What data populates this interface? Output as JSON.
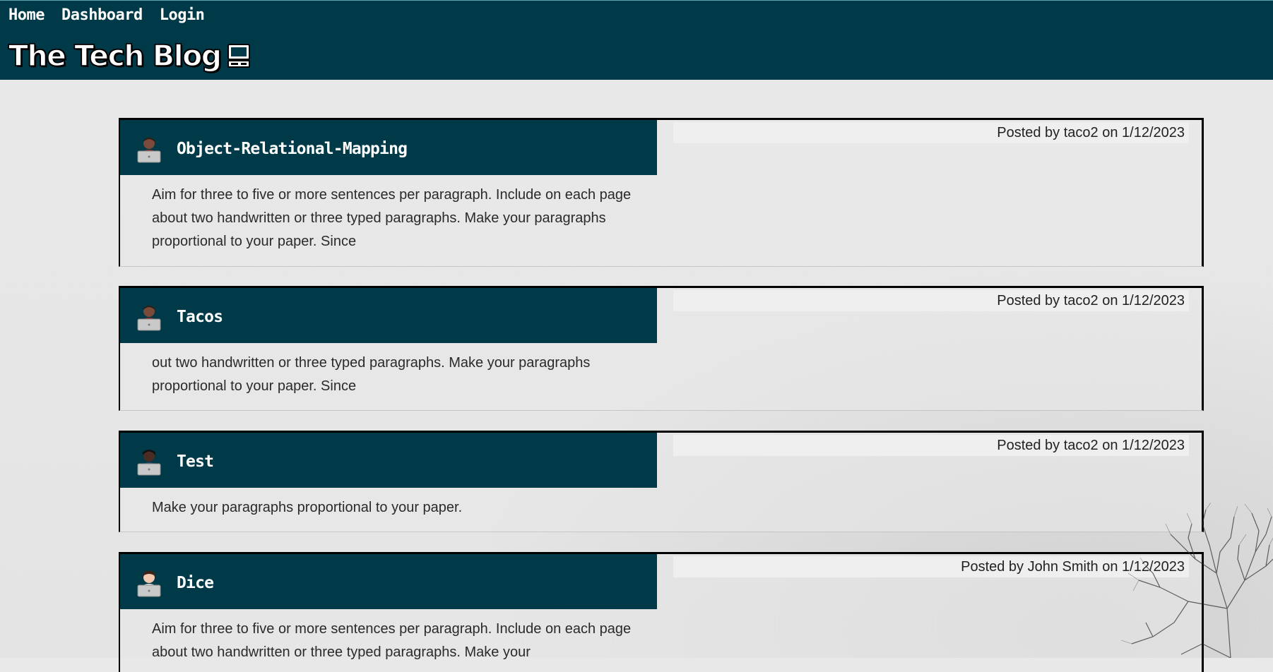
{
  "nav": {
    "home": "Home",
    "dashboard": "Dashboard",
    "login": "Login"
  },
  "site": {
    "title": "The Tech Blog",
    "icon": "computer-icon"
  },
  "posts": [
    {
      "title": "Object-Relational-Mapping",
      "meta": "Posted by taco2 on 1/12/2023",
      "body": "Aim for three to five or more sentences per paragraph. Include on each page about two handwritten or three typed paragraphs. Make your paragraphs proportional to your paper. Since",
      "avatar": "person-with-laptop-icon"
    },
    {
      "title": "Tacos",
      "meta": "Posted by taco2 on 1/12/2023",
      "body": "out two handwritten or three typed paragraphs. Make your paragraphs proportional to your paper. Since",
      "avatar": "person-with-laptop-icon"
    },
    {
      "title": "Test",
      "meta": "Posted by taco2 on 1/12/2023",
      "body": "Make your paragraphs proportional to your paper.",
      "avatar": "person-with-laptop-icon"
    },
    {
      "title": "Dice",
      "meta": "Posted by John Smith on 1/12/2023",
      "body": "Aim for three to five or more sentences per paragraph. Include on each page about two handwritten or three typed paragraphs. Make your",
      "avatar": "person-with-laptop-icon"
    }
  ],
  "colors": {
    "header_bg": "#003a48",
    "text": "#2a2a2a",
    "meta_bg": "#efefef"
  }
}
